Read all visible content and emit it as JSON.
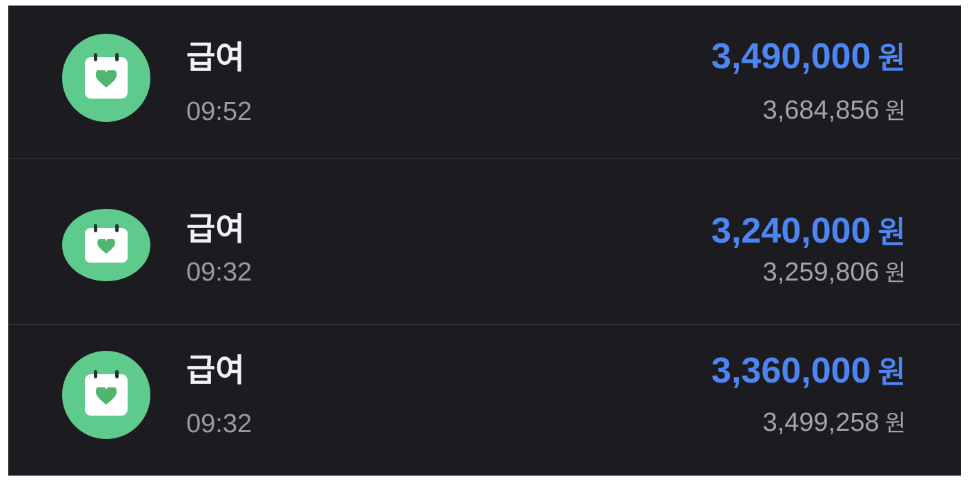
{
  "currency_unit": "원",
  "colors": {
    "background": "#1b1b20",
    "icon_circle": "#5ecb8c",
    "amount": "#4d86f2",
    "title": "#f2f2f5",
    "secondary_text": "#9a9aa2"
  },
  "transactions": [
    {
      "icon": "calendar-heart-icon",
      "title": "급여",
      "time": "09:52",
      "amount": "3,490,000",
      "balance": "3,684,856"
    },
    {
      "icon": "calendar-heart-icon",
      "title": "급여",
      "time": "09:32",
      "amount": "3,240,000",
      "balance": "3,259,806"
    },
    {
      "icon": "calendar-heart-icon",
      "title": "급여",
      "time": "09:32",
      "amount": "3,360,000",
      "balance": "3,499,258"
    }
  ]
}
